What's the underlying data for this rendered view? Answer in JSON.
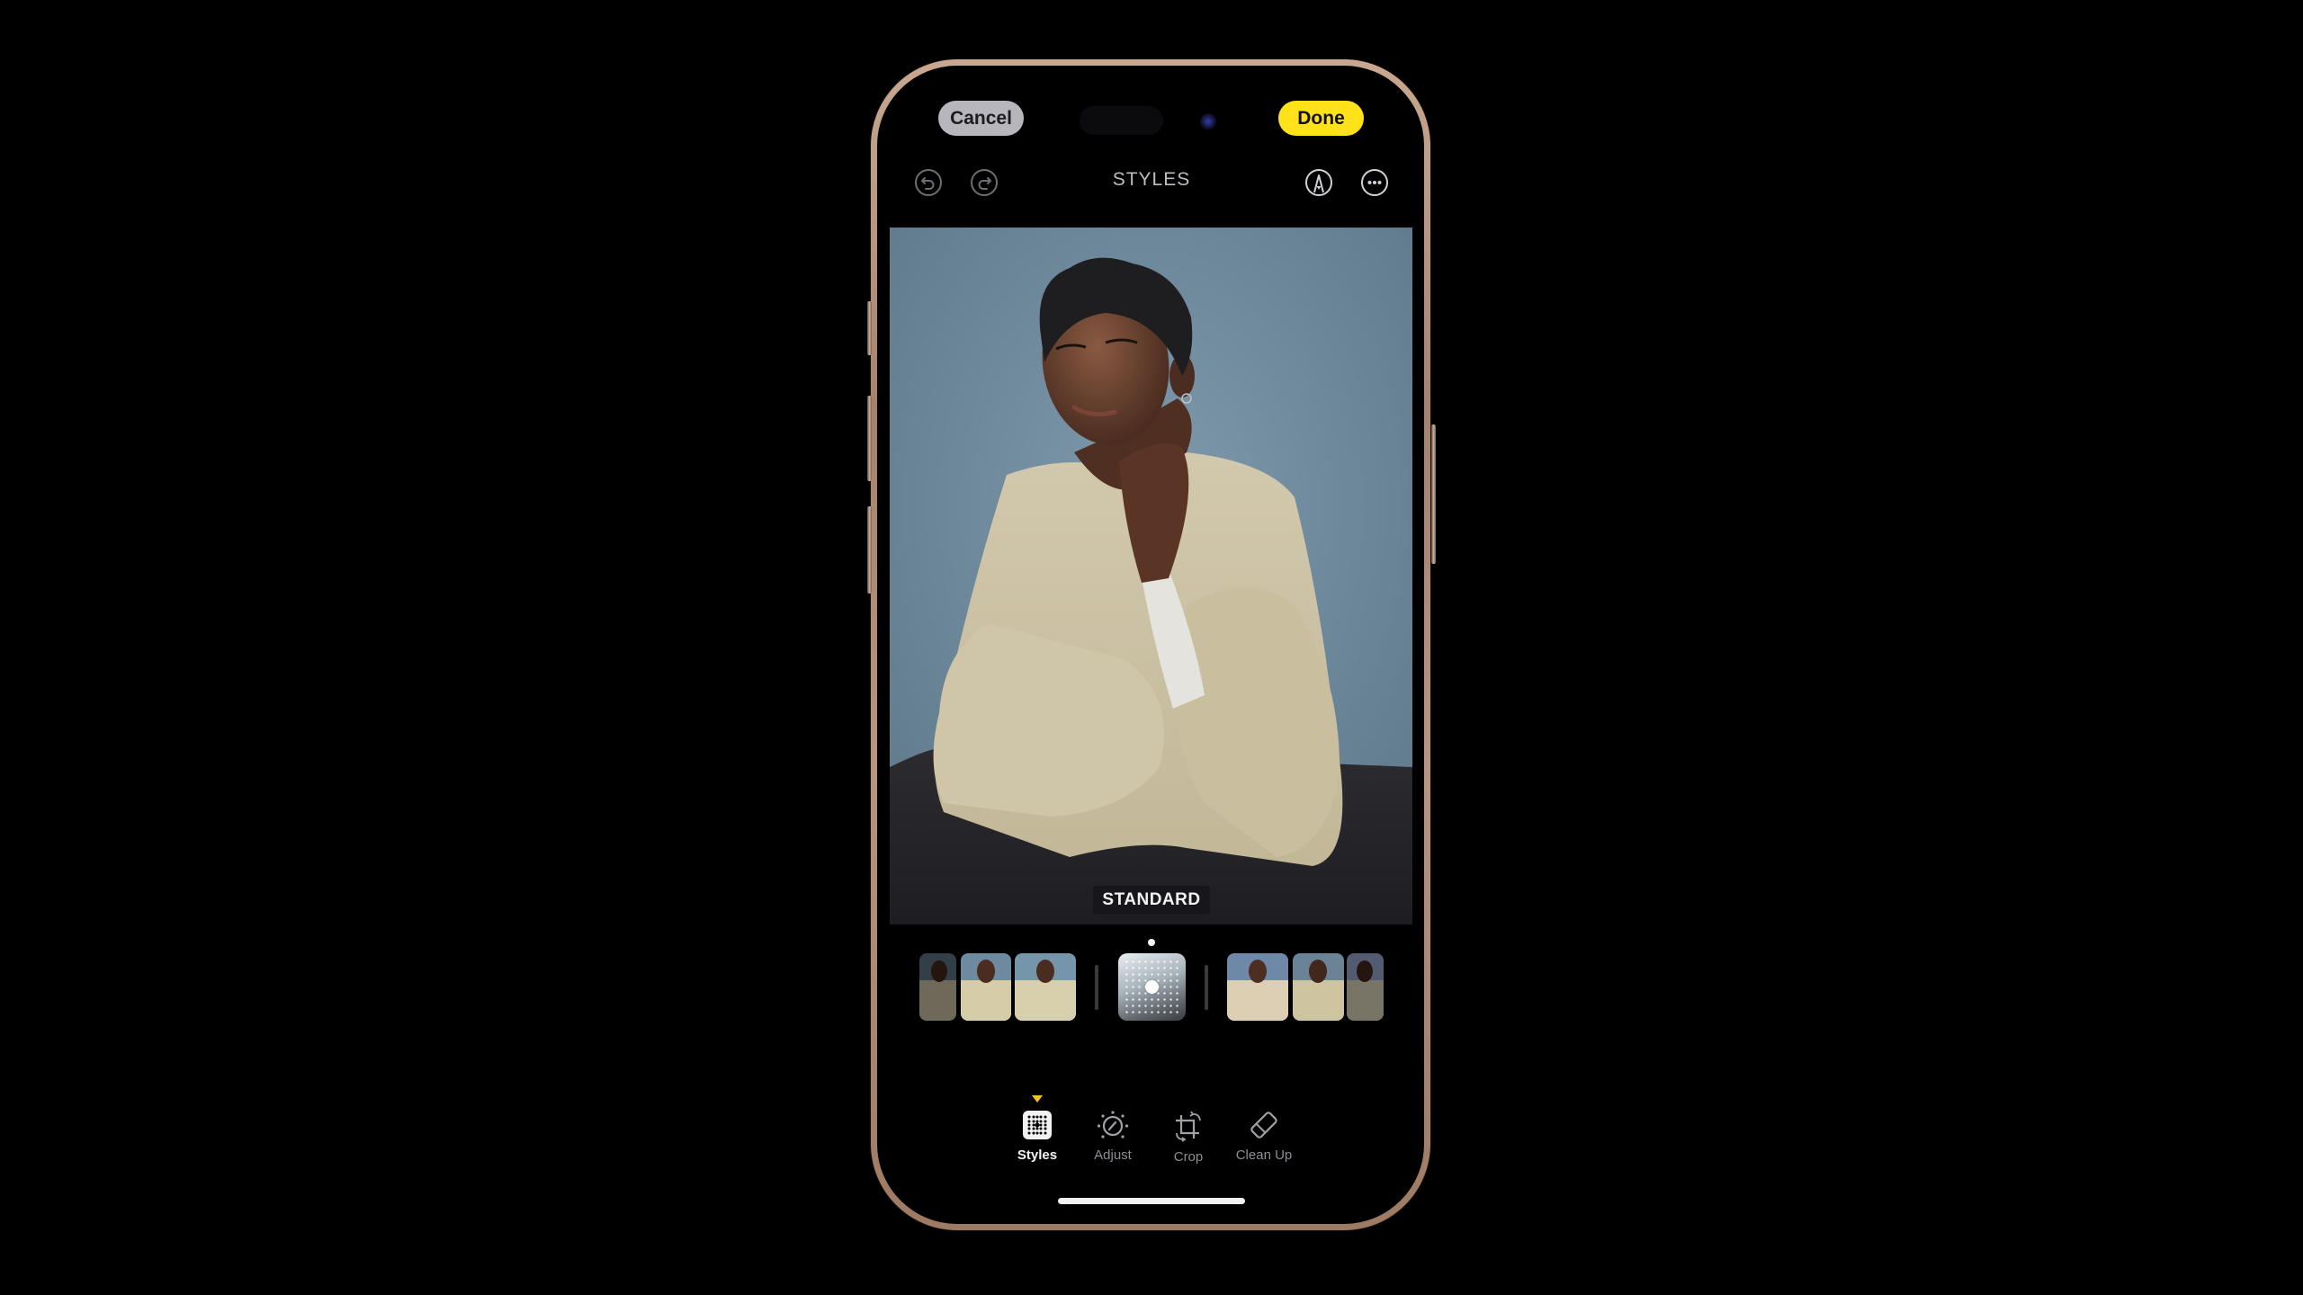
{
  "top_bar": {
    "cancel_label": "Cancel",
    "done_label": "Done",
    "done_color": "#ffe21a"
  },
  "toolbar": {
    "title": "STYLES",
    "left_icons": [
      "undo-icon",
      "redo-icon"
    ],
    "right_icons": [
      "markup-icon",
      "more-icon"
    ]
  },
  "photo": {
    "style_label": "STANDARD"
  },
  "styles_strip": {
    "left_thumbnails": 3,
    "right_thumbnails": 3,
    "selected": "style-pad"
  },
  "tabs": [
    {
      "label": "Styles",
      "icon": "styles-grid-icon",
      "active": true
    },
    {
      "label": "Adjust",
      "icon": "adjust-dial-icon",
      "active": false
    },
    {
      "label": "Crop",
      "icon": "crop-rotate-icon",
      "active": false
    },
    {
      "label": "Clean Up",
      "icon": "eraser-icon",
      "active": false
    }
  ],
  "colors": {
    "accent": "#f5c518",
    "frame": "#b8957e"
  }
}
